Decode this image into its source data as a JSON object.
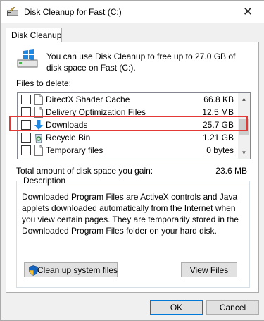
{
  "window": {
    "title": "Disk Cleanup for Fast (C:)",
    "close_glyph": "✕"
  },
  "tabs": [
    {
      "label": "Disk Cleanup",
      "selected": true
    }
  ],
  "intro_text": "You can use Disk Cleanup to free up to 27.0 GB of disk space on Fast (C:).",
  "files_label": {
    "accel": "F",
    "rest": "iles to delete:"
  },
  "files": [
    {
      "name": "DirectX Shader Cache",
      "size": "66.8 KB",
      "checked": false,
      "icon": "file-icon"
    },
    {
      "name": "Delivery Optimization Files",
      "size": "12.5 MB",
      "checked": false,
      "icon": "file-icon"
    },
    {
      "name": "Downloads",
      "size": "25.7 GB",
      "checked": false,
      "icon": "download-arrow-icon"
    },
    {
      "name": "Recycle Bin",
      "size": "1.21 GB",
      "checked": false,
      "icon": "recycle-bin-icon"
    },
    {
      "name": "Temporary files",
      "size": "0 bytes",
      "checked": false,
      "icon": "file-icon"
    }
  ],
  "total": {
    "label": "Total amount of disk space you gain:",
    "value": "23.6 MB"
  },
  "description": {
    "legend": "Description",
    "text": "Downloaded Program Files are ActiveX controls and Java applets downloaded automatically from the Internet when you view certain pages. They are temporarily stored in the Downloaded Program Files folder on your hard disk."
  },
  "buttons": {
    "cleanup_pre": "Clean up ",
    "cleanup_accel": "s",
    "cleanup_post": "ystem files",
    "view_accel": "V",
    "view_rest": "iew Files",
    "ok": "OK",
    "cancel": "Cancel"
  },
  "colors": {
    "highlight": "#e53935",
    "accent": "#0078d7"
  }
}
